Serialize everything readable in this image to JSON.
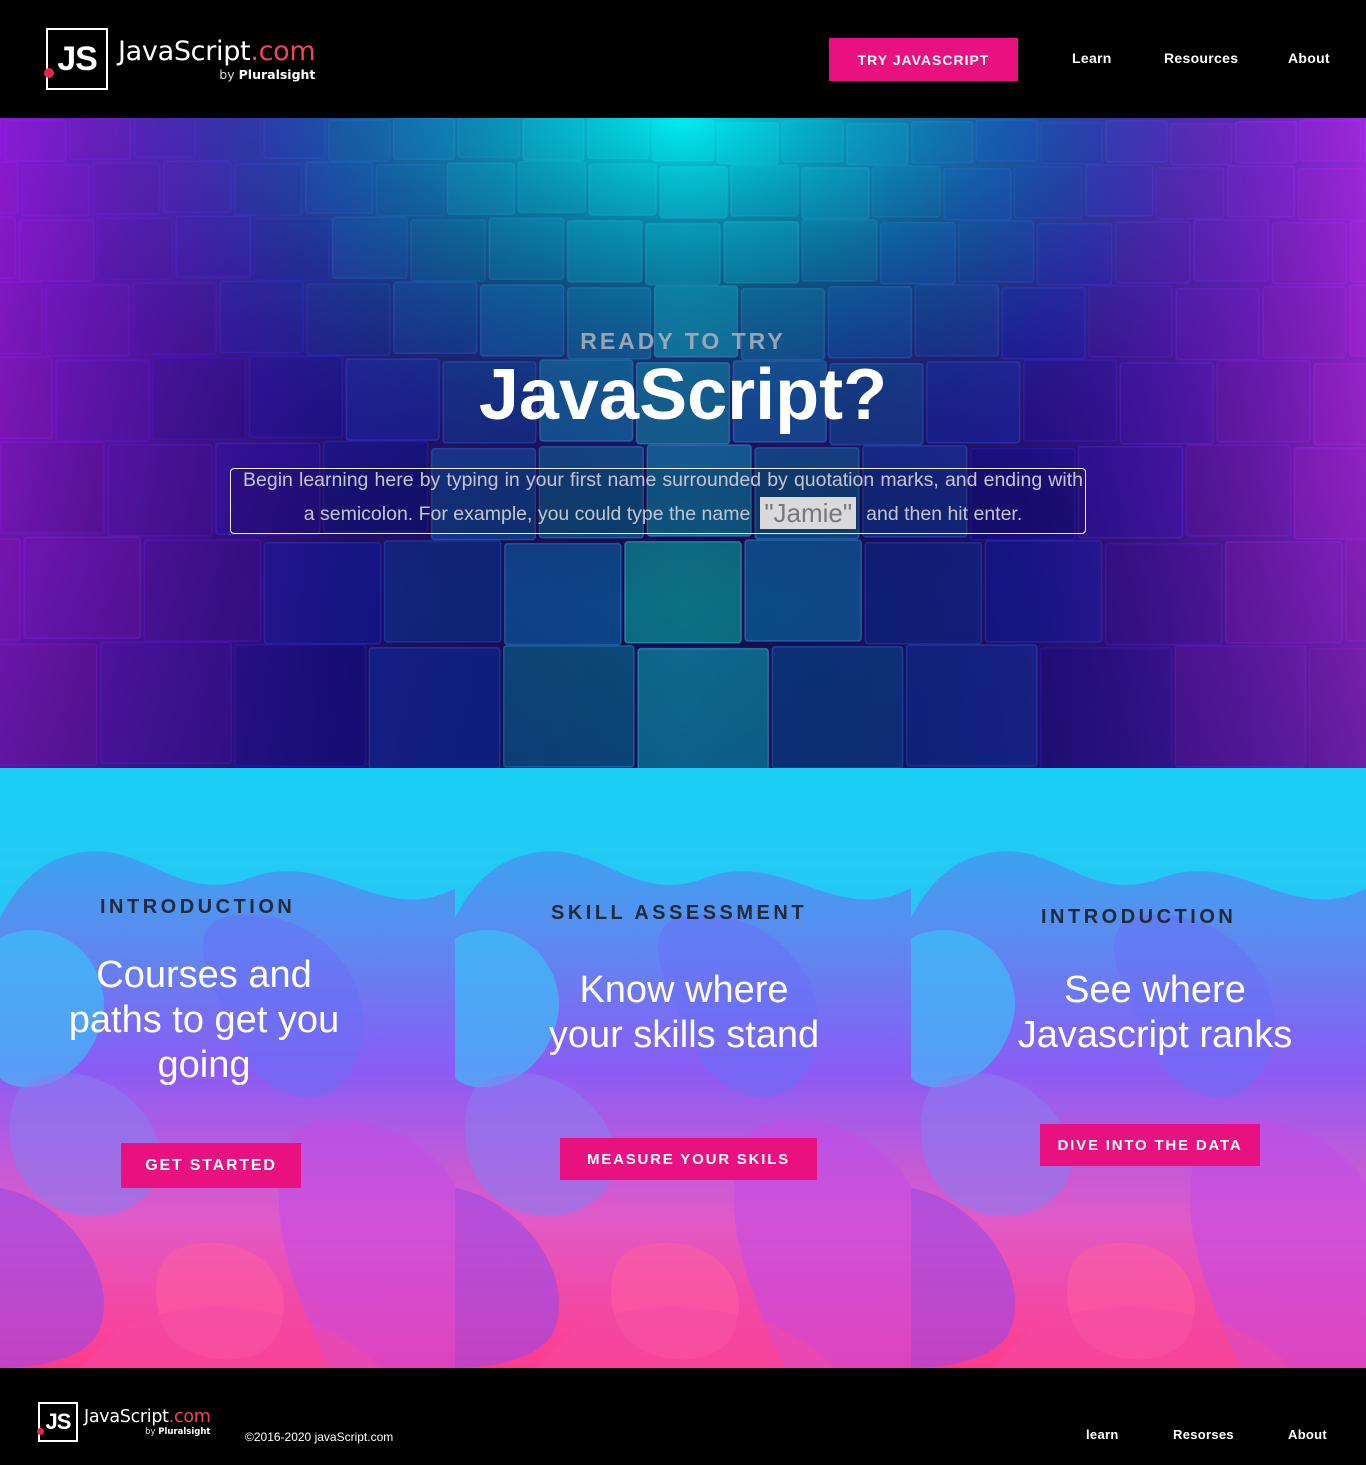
{
  "header": {
    "logo": {
      "mark": "JS",
      "name": "JavaScript",
      "tld": ".com",
      "by_prefix": "by",
      "by_brand": "Pluralsight"
    },
    "cta_label": "TRY JAVASCRIPT",
    "nav": [
      {
        "label": "Learn"
      },
      {
        "label": "Resources"
      },
      {
        "label": "About"
      }
    ]
  },
  "hero": {
    "kicker": "READY TO TRY",
    "title": "JavaScript?",
    "text_before": "Begin learning here by typing in your first name surrounded by quotation marks, and ending with a semicolon. For example, you could type the name",
    "example_name": "\"Jamie\"",
    "text_after": "and then hit enter.",
    "input_value": "",
    "input_placeholder": ""
  },
  "cards": [
    {
      "kicker": "INTRODUCTION",
      "title": "Courses and paths to get you going",
      "button": "GET STARTED"
    },
    {
      "kicker": "SKILL ASSESSMENT",
      "title": "Know where your skills stand",
      "button": "MEASURE YOUR SKILS"
    },
    {
      "kicker": "INTRODUCTION",
      "title": "See where Javascript ranks",
      "button": "DIVE INTO THE DATA"
    }
  ],
  "footer": {
    "logo": {
      "mark": "JS",
      "name": "JavaScript",
      "tld": ".com",
      "by_prefix": "by",
      "by_brand": "Pluralsight"
    },
    "copyright": "©2016-2020 javaScript.com",
    "nav": [
      {
        "label": "learn"
      },
      {
        "label": "Resorses"
      },
      {
        "label": "About"
      }
    ]
  },
  "colors": {
    "accent": "#e8117f",
    "logo_dot": "#e8254b",
    "hero_cyan": "#00e8f0",
    "hero_purple": "#9a2cff"
  }
}
